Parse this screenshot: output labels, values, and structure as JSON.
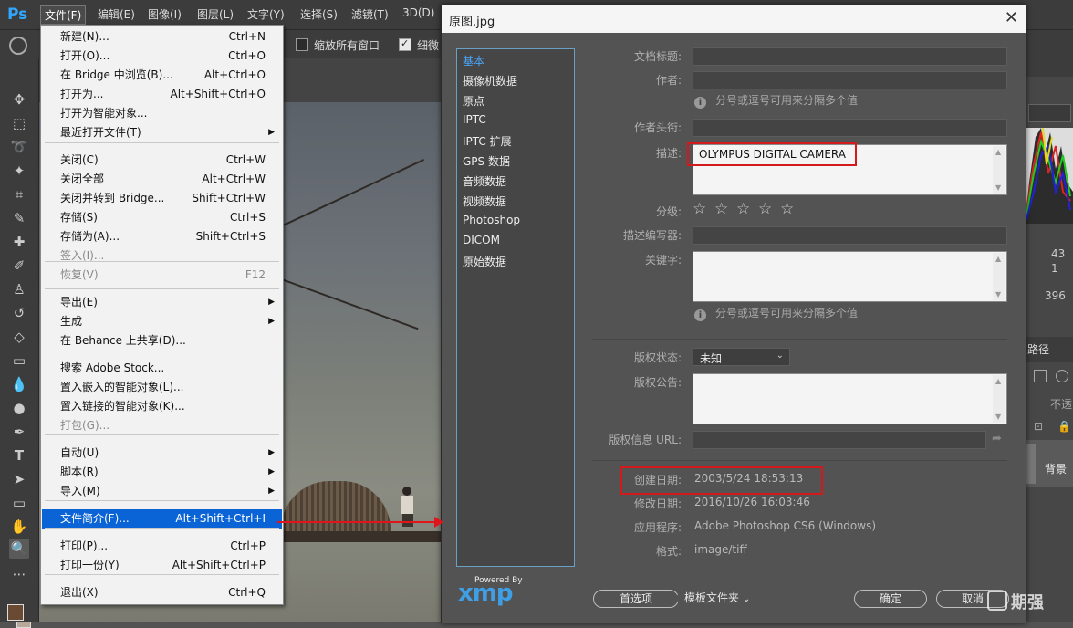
{
  "menubar": {
    "items": [
      "文件(F)",
      "编辑(E)",
      "图像(I)",
      "图层(L)",
      "文字(Y)",
      "选择(S)",
      "滤镜(T)",
      "3D(D)"
    ]
  },
  "options_bar": {
    "zoom_all_label": "缩放所有窗口",
    "scrubby_label": "细微"
  },
  "file_menu": {
    "items": [
      {
        "label": "新建(N)...",
        "shortcut": "Ctrl+N"
      },
      {
        "label": "打开(O)...",
        "shortcut": "Ctrl+O"
      },
      {
        "label": "在 Bridge 中浏览(B)...",
        "shortcut": "Alt+Ctrl+O"
      },
      {
        "label": "打开为...",
        "shortcut": "Alt+Shift+Ctrl+O"
      },
      {
        "label": "打开为智能对象...",
        "shortcut": ""
      },
      {
        "label": "最近打开文件(T)",
        "shortcut": ""
      },
      {
        "label": "关闭(C)",
        "shortcut": "Ctrl+W"
      },
      {
        "label": "关闭全部",
        "shortcut": "Alt+Ctrl+W"
      },
      {
        "label": "关闭并转到 Bridge...",
        "shortcut": "Shift+Ctrl+W"
      },
      {
        "label": "存储(S)",
        "shortcut": "Ctrl+S"
      },
      {
        "label": "存储为(A)...",
        "shortcut": "Shift+Ctrl+S"
      },
      {
        "label": "签入(I)...",
        "shortcut": ""
      },
      {
        "label": "恢复(V)",
        "shortcut": "F12"
      },
      {
        "label": "导出(E)",
        "shortcut": ""
      },
      {
        "label": "生成",
        "shortcut": ""
      },
      {
        "label": "在 Behance 上共享(D)...",
        "shortcut": ""
      },
      {
        "label": "搜索 Adobe Stock...",
        "shortcut": ""
      },
      {
        "label": "置入嵌入的智能对象(L)...",
        "shortcut": ""
      },
      {
        "label": "置入链接的智能对象(K)...",
        "shortcut": ""
      },
      {
        "label": "打包(G)...",
        "shortcut": ""
      },
      {
        "label": "自动(U)",
        "shortcut": ""
      },
      {
        "label": "脚本(R)",
        "shortcut": ""
      },
      {
        "label": "导入(M)",
        "shortcut": ""
      },
      {
        "label": "文件简介(F)...",
        "shortcut": "Alt+Shift+Ctrl+I"
      },
      {
        "label": "打印(P)...",
        "shortcut": "Ctrl+P"
      },
      {
        "label": "打印一份(Y)",
        "shortcut": "Alt+Shift+Ctrl+P"
      },
      {
        "label": "退出(X)",
        "shortcut": "Ctrl+Q"
      }
    ]
  },
  "dialog": {
    "title": "原图.jpg",
    "sidebar": [
      "基本",
      "摄像机数据",
      "原点",
      "IPTC",
      "IPTC 扩展",
      "GPS 数据",
      "音频数据",
      "视频数据",
      "Photoshop",
      "DICOM",
      "原始数据"
    ],
    "labels": {
      "doc_title": "文档标题:",
      "author": "作者:",
      "author_title": "作者头衔:",
      "description": "描述:",
      "rating": "分级:",
      "desc_writer": "描述编写器:",
      "keywords": "关键字:",
      "copyright_status": "版权状态:",
      "copyright_notice": "版权公告:",
      "copyright_url": "版权信息 URL:",
      "created": "创建日期:",
      "modified": "修改日期:",
      "application": "应用程序:",
      "format": "格式:"
    },
    "hint_author": "分号或逗号可用来分隔多个值",
    "hint_keywords": "分号或逗号可用来分隔多个值",
    "description_value": "OLYMPUS DIGITAL CAMERA",
    "copyright_status_value": "未知",
    "created_value": "2003/5/24 18:53:13",
    "modified_value": "2016/10/26 16:03:46",
    "application_value": "Adobe Photoshop CS6 (Windows)",
    "format_value": "image/tiff",
    "xmp_caption": "Powered By",
    "xmp_logo": "xmp",
    "buttons": {
      "preferences": "首选项",
      "template": "模板文件夹",
      "ok": "确定",
      "cancel": "取消"
    }
  },
  "right_panel": {
    "nums": [
      "43",
      "1",
      "396"
    ],
    "tab": "路径",
    "opacity_label": "不透",
    "layer_name": "背景"
  },
  "watermark": "期强"
}
